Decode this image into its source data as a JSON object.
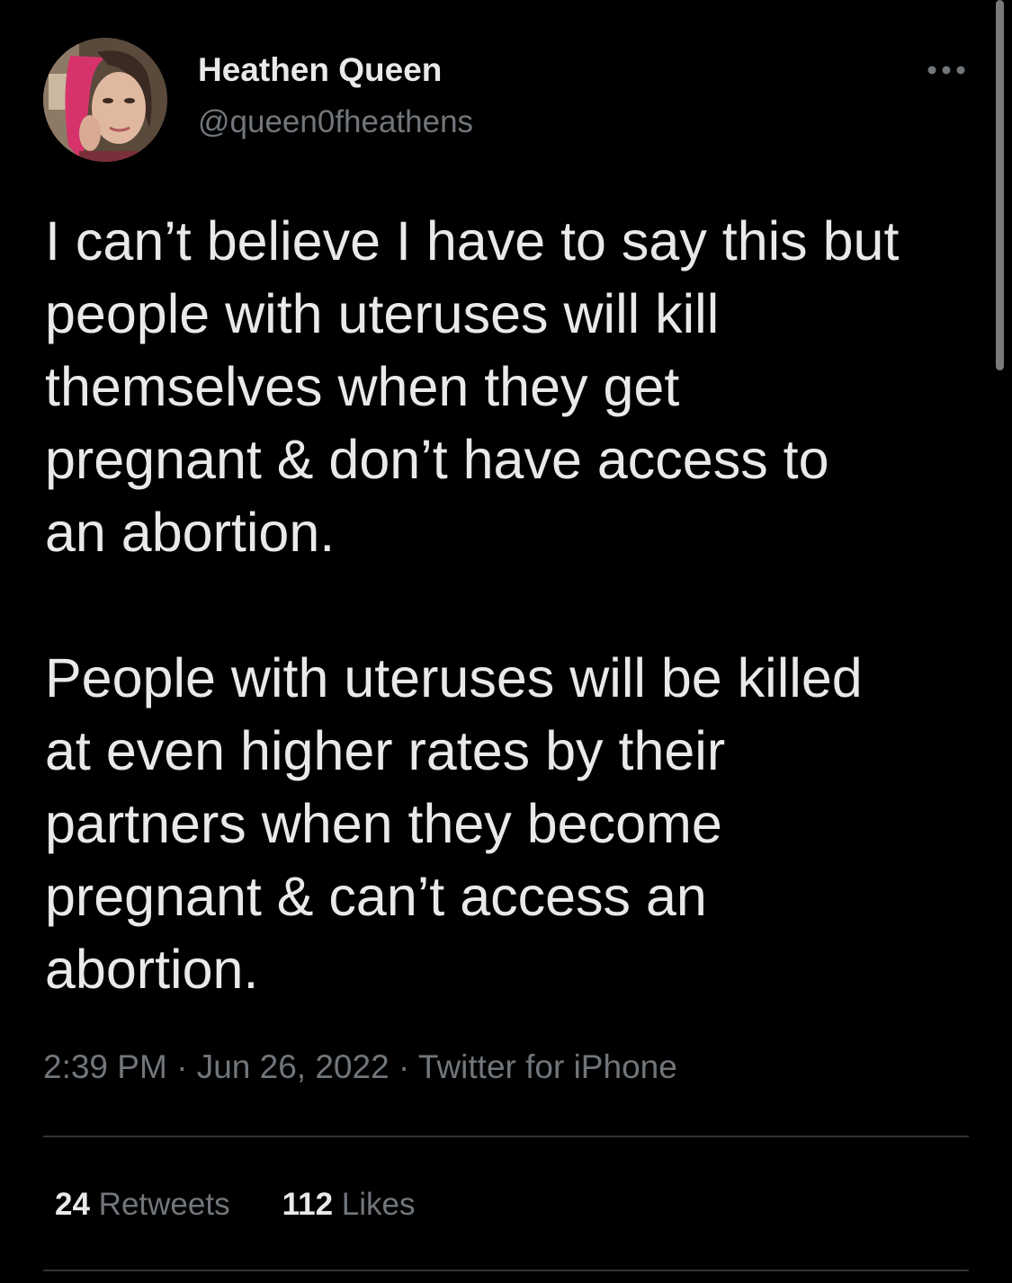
{
  "tweet": {
    "author": {
      "display_name": "Heathen Queen",
      "handle": "@queen0fheathens",
      "avatar_icon": "profile-photo"
    },
    "more_icon": "ellipsis-icon",
    "text": "I can’t believe I have to say this but\npeople with uteruses will kill\nthemselves when they get\npregnant & don’t have access to\nan abortion.\n\nPeople with uteruses will be killed\nat even higher rates by their\npartners when they become\npregnant & can’t access an\nabortion.",
    "time": "2:39 PM",
    "separator": "·",
    "date": "Jun 26, 2022",
    "source": "Twitter for iPhone",
    "stats": {
      "retweets_count": "24",
      "retweets_label": "Retweets",
      "likes_count": "112",
      "likes_label": "Likes"
    }
  },
  "colors": {
    "background": "#000000",
    "primary_text": "#e7e9ea",
    "secondary_text": "#71767b",
    "divider": "#2f3336"
  }
}
